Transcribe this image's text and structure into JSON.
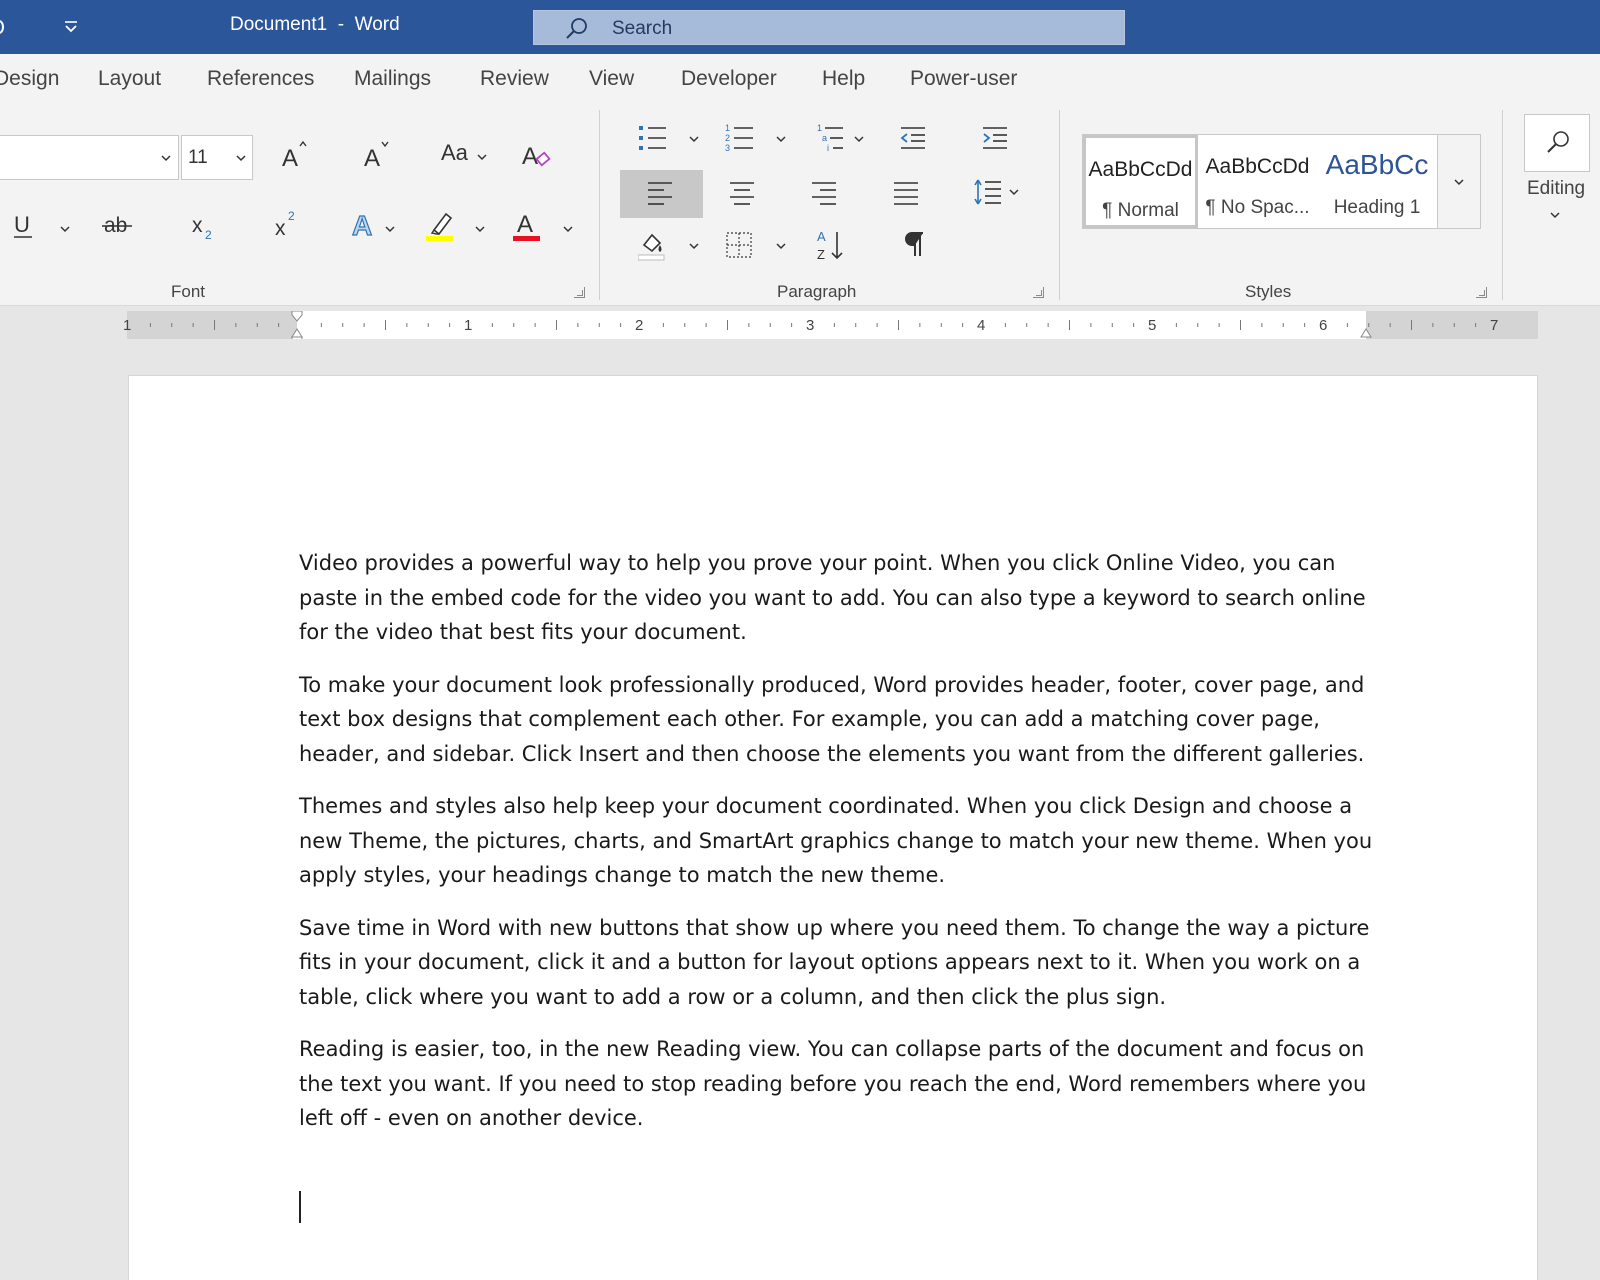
{
  "window": {
    "document_name": "Document1",
    "separator": "-",
    "app_name": "Word"
  },
  "search": {
    "placeholder": "Search"
  },
  "tabs": [
    "Design",
    "Layout",
    "References",
    "Mailings",
    "Review",
    "View",
    "Developer",
    "Help",
    "Power-user"
  ],
  "ribbon": {
    "font": {
      "font_name": "",
      "font_size": "11",
      "change_case_label": "Aa",
      "group_label": "Font",
      "icons": [
        "grow-font-icon",
        "shrink-font-icon",
        "change-case-icon",
        "clear-formatting-icon",
        "underline-icon",
        "strikethrough-icon",
        "subscript-icon",
        "superscript-icon",
        "text-effects-icon",
        "highlight-icon",
        "font-color-icon"
      ],
      "colors": {
        "highlight": "#ffff00",
        "font_color": "#e81123",
        "text_effects": "#2e75b6"
      }
    },
    "paragraph": {
      "group_label": "Paragraph",
      "icons": [
        "bullets-icon",
        "numbering-icon",
        "multilevel-list-icon",
        "decrease-indent-icon",
        "increase-indent-icon",
        "align-left-icon",
        "center-icon",
        "align-right-icon",
        "justify-icon",
        "line-spacing-icon",
        "shading-icon",
        "borders-icon",
        "sort-icon",
        "show-formatting-marks-icon"
      ],
      "active": "align-left"
    },
    "styles": {
      "group_label": "Styles",
      "items": [
        {
          "preview": "AaBbCcDd",
          "name": "¶ Normal",
          "selected": true
        },
        {
          "preview": "AaBbCcDd",
          "name": "¶ No Spac...",
          "selected": false
        },
        {
          "preview": "AaBbCc",
          "name": "Heading 1",
          "selected": false,
          "color": "#2f5496"
        }
      ]
    },
    "editing": {
      "label": "Editing"
    }
  },
  "ruler": {
    "numbers": [
      "1",
      "1",
      "2",
      "3",
      "4",
      "5",
      "6",
      "7"
    ]
  },
  "document": {
    "paragraphs": [
      "Video provides a powerful way to help you prove your point. When you click Online Video, you can paste in the embed code for the video you want to add. You can also type a keyword to search online for the video that best fits your document.",
      "To make your document look professionally produced, Word provides header, footer, cover page, and text box designs that complement each other. For example, you can add a matching cover page, header, and sidebar. Click Insert and then choose the elements you want from the different galleries.",
      "Themes and styles also help keep your document coordinated. When you click Design and choose a new Theme, the pictures, charts, and SmartArt graphics change to match your new theme. When you apply styles, your headings change to match the new theme.",
      "Save time in Word with new buttons that show up where you need them. To change the way a picture fits in your document, click it and a button for layout options appears next to it. When you work on a table, click where you want to add a row or a column, and then click the plus sign.",
      "Reading is easier, too, in the new Reading view. You can collapse parts of the document and focus on the text you want. If you need to stop reading before you reach the end, Word remembers where you left off - even on another device."
    ]
  },
  "colors": {
    "title_bar": "#2b579a",
    "ribbon": "#f3f3f3",
    "workspace": "#e6e6e6",
    "search_box": "#a6bbda"
  }
}
